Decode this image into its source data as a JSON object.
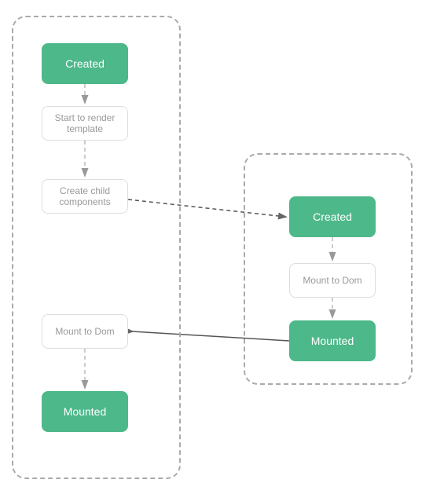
{
  "nodes": {
    "created_left": "Created",
    "render_left": "Start to render template",
    "child_left": "Create child components",
    "mount_dom_left": "Mount to Dom",
    "mounted_left": "Mounted",
    "created_right": "Created",
    "mount_dom_right": "Mount to Dom",
    "mounted_right": "Mounted"
  },
  "colors": {
    "green": "#4db88a",
    "white_bg": "#ffffff",
    "border": "#aaaaaa",
    "arrow": "#aaaaaa",
    "arrow_dark": "#555555"
  }
}
